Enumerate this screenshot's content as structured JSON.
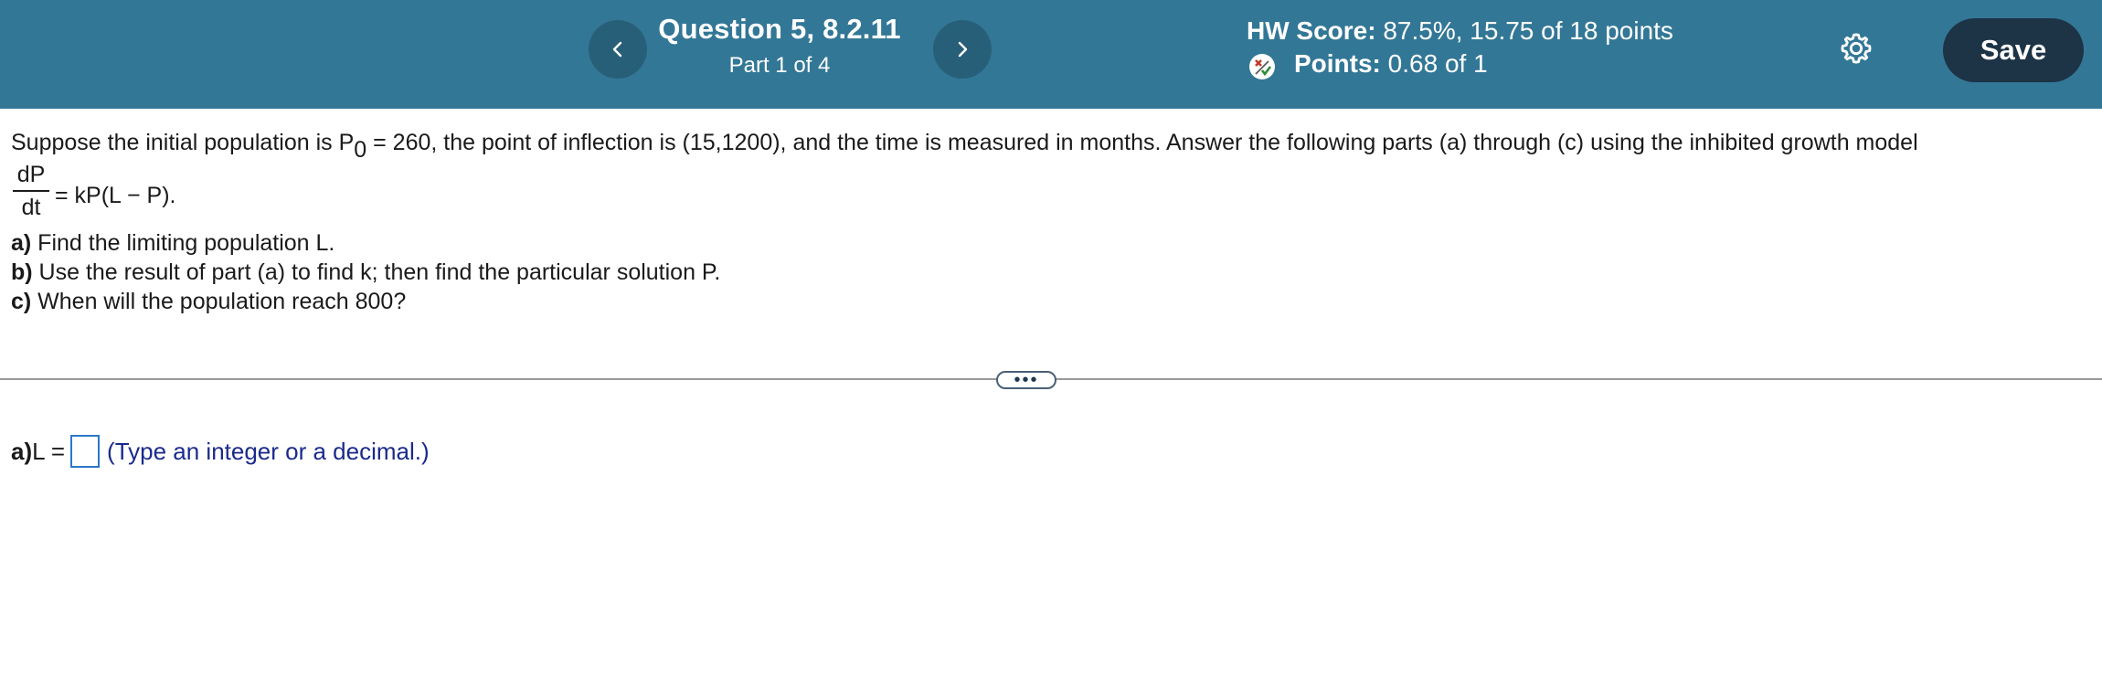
{
  "header": {
    "question_title": "Question 5, 8.2.11",
    "part_label": "Part 1 of 4",
    "hw_score_label": "HW Score:",
    "hw_score_value": "87.5%, 15.75 of 18 points",
    "points_label": "Points:",
    "points_value": "0.68 of 1",
    "save_label": "Save",
    "colors": {
      "bar": "#337796",
      "nav_button": "#285f78",
      "save_button": "#1d3346"
    },
    "icons": [
      "chevron-left-icon",
      "chevron-right-icon",
      "partial-credit-icon",
      "gear-icon"
    ]
  },
  "question": {
    "intro_a": "Suppose the initial population is P",
    "intro_sub": "0",
    "intro_b": " = 260, the point of inflection is (15,1200), and the time is measured in months. Answer the following parts (a) through (c) using the inhibited growth model",
    "eq_numerator": "dP",
    "eq_denominator": "dt",
    "eq_rest": "= kP(L − P).",
    "parts": [
      {
        "label": "a)",
        "text": " Find the limiting population L."
      },
      {
        "label": "b)",
        "text": " Use the result of part (a) to find k; then find the particular solution P."
      },
      {
        "label": "c)",
        "text": " When will the population reach 800?"
      }
    ]
  },
  "answer": {
    "label": "a)",
    "prefix": " L =",
    "value": "",
    "hint": "(Type an integer or a decimal.)"
  }
}
